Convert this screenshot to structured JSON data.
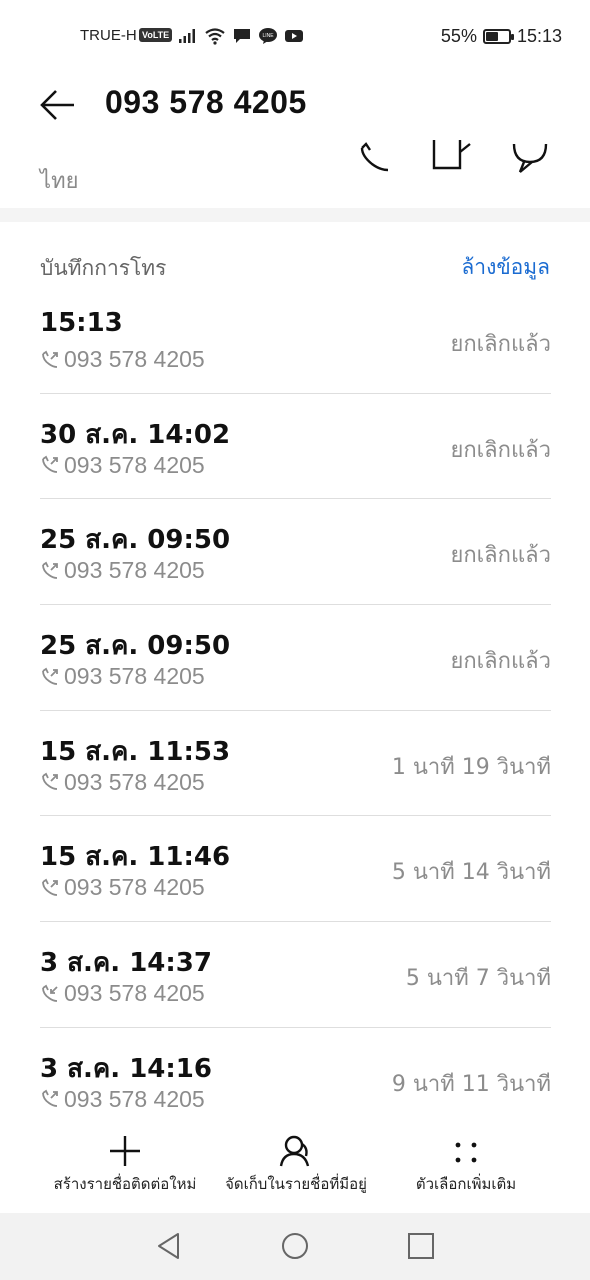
{
  "status_bar": {
    "carrier": "TRUE-H",
    "volte": "VoLTE",
    "battery": "55%",
    "battery_level": 0.55,
    "time": "15:13"
  },
  "header": {
    "title": "093 578 4205",
    "region": "ไทย"
  },
  "call_log": {
    "title": "บันทึกการโทร",
    "clear_label": "ล้างข้อมูล",
    "items": [
      {
        "time": "15:13",
        "number": "093 578 4205",
        "status": "ยกเลิกแล้ว",
        "type": "outgoing"
      },
      {
        "time": "30 ส.ค. 14:02",
        "number": "093 578 4205",
        "status": "ยกเลิกแล้ว",
        "type": "outgoing"
      },
      {
        "time": "25 ส.ค. 09:50",
        "number": "093 578 4205",
        "status": "ยกเลิกแล้ว",
        "type": "outgoing"
      },
      {
        "time": "25 ส.ค. 09:50",
        "number": "093 578 4205",
        "status": "ยกเลิกแล้ว",
        "type": "outgoing"
      },
      {
        "time": "15 ส.ค. 11:53",
        "number": "093 578 4205",
        "status": "1 นาที 19 วินาที",
        "type": "outgoing"
      },
      {
        "time": "15 ส.ค. 11:46",
        "number": "093 578 4205",
        "status": "5 นาที 14 วินาที",
        "type": "outgoing"
      },
      {
        "time": "3 ส.ค. 14:37",
        "number": "093 578 4205",
        "status": "5 นาที 7 วินาที",
        "type": "incoming"
      },
      {
        "time": "3 ส.ค. 14:16",
        "number": "093 578 4205",
        "status": "9 นาที 11 วินาที",
        "type": "outgoing"
      }
    ]
  },
  "toolbar": {
    "new_contact": "สร้างรายชื่อติดต่อใหม่",
    "save_existing": "จัดเก็บในรายชื่อที่มีอยู่",
    "more_options": "ตัวเลือกเพิ่มเติม"
  },
  "colors": {
    "accent": "#1a6bd1",
    "secondary_text": "#8c8c8c"
  }
}
